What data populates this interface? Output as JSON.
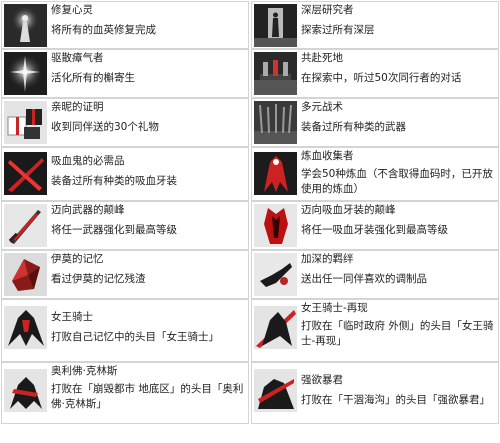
{
  "achievements": [
    {
      "title": "修复心灵",
      "desc": "将所有的血英修复完成",
      "icon": "glowing-figure-icon"
    },
    {
      "title": "深层研究者",
      "desc": "探索过所有深层",
      "icon": "dark-doorway-icon"
    },
    {
      "title": "驱散瘴气者",
      "desc": "活化所有的槲寄生",
      "icon": "light-burst-icon"
    },
    {
      "title": "共赴死地",
      "desc": "在探索中，听过50次同行者的对话",
      "icon": "companions-stairs-icon"
    },
    {
      "title": "亲昵的证明",
      "desc": "收到同伴送的30个礼物",
      "icon": "gift-boxes-icon"
    },
    {
      "title": "多元战术",
      "desc": "装备过所有种类的武器",
      "icon": "weapon-rack-icon"
    },
    {
      "title": "吸血鬼的必需品",
      "desc": "装备过所有种类的吸血牙装",
      "icon": "crossed-blades-icon"
    },
    {
      "title": "炼血收集者",
      "desc": "学会50种炼血（不含取得血码时，已开放使用的炼血）",
      "icon": "red-figure-icon"
    },
    {
      "title": "迈向武器的颠峰",
      "desc": "将任一武器强化到最高等级",
      "icon": "sword-icon"
    },
    {
      "title": "迈向吸血牙装的颠峰",
      "desc": "将任一吸血牙装强化到最高等级",
      "icon": "armor-icon"
    },
    {
      "title": "伊莫的记忆",
      "desc": "看过伊莫的记忆残渣",
      "icon": "crystal-shard-icon"
    },
    {
      "title": "加深的羁绊",
      "desc": "送出任一同伴喜欢的调制品",
      "icon": "reaching-hand-icon"
    },
    {
      "title": "女王骑士",
      "desc": "打败自己记忆中的头目「女王骑士」",
      "icon": "queen-knight-icon"
    },
    {
      "title": "女王骑士-再现",
      "desc": "打败在「临时政府 外侧」的头目「女王骑士-再现」",
      "icon": "queen-knight-icon"
    },
    {
      "title": "奥利佛·克林斯",
      "desc": "打败在「崩毁都市 地底区」的头目「奥利佛·克林斯」",
      "icon": "red-warrior-icon"
    },
    {
      "title": "强欲暴君",
      "desc": "打败在「干涸海沟」的头目「强欲暴君」",
      "icon": "tyrant-icon"
    }
  ]
}
